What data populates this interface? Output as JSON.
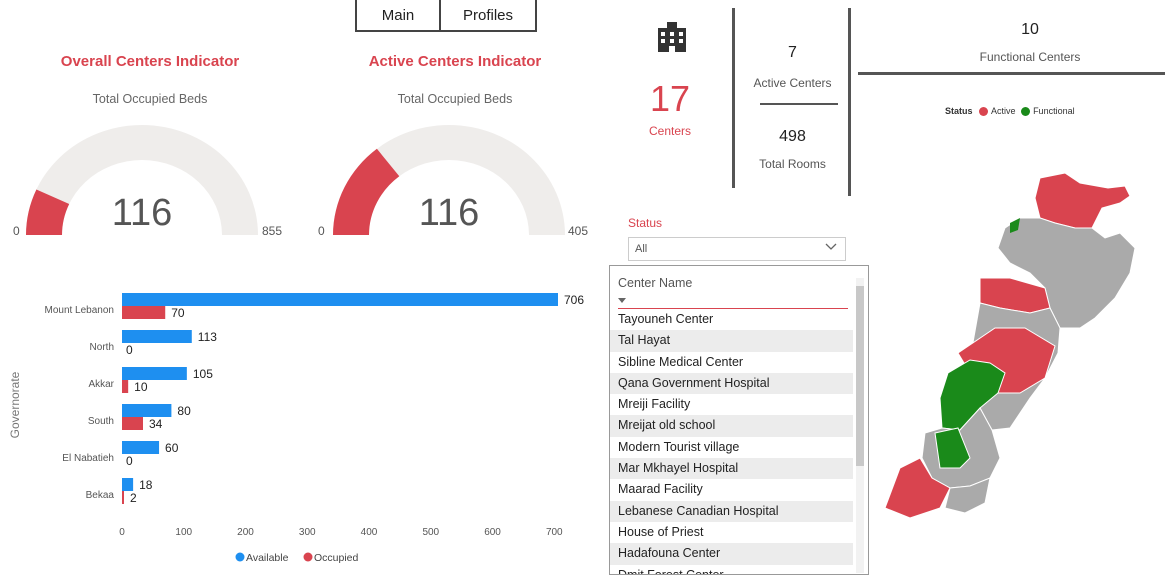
{
  "nav": {
    "main_label": "Main",
    "profiles_label": "Profiles"
  },
  "gauge_overall": {
    "title": "Overall Centers Indicator",
    "subtitle": "Total Occupied Beds",
    "value": "116",
    "min": "0",
    "max": "855"
  },
  "gauge_active": {
    "title": "Active Centers Indicator",
    "subtitle": "Total Occupied Beds",
    "value": "116",
    "min": "0",
    "max": "405"
  },
  "kpi": {
    "building_icon": "building-icon",
    "centers_value": "17",
    "centers_label": "Centers",
    "active_value": "7",
    "active_label": "Active Centers",
    "rooms_value": "498",
    "rooms_label": "Total Rooms",
    "functional_value": "10",
    "functional_label": "Functional Centers"
  },
  "map_legend": {
    "title": "Status",
    "items": [
      {
        "label": "Active",
        "color": "#d9444f"
      },
      {
        "label": "Functional",
        "color": "#1a8a1a"
      }
    ]
  },
  "status_slicer": {
    "title": "Status",
    "selected": "All"
  },
  "center_table": {
    "header": "Center Name",
    "rows": [
      "Tayouneh Center",
      "Tal Hayat",
      "Sibline Medical Center",
      "Qana Government Hospital",
      "Mreiji Facility",
      "Mreijat old school",
      "Modern Tourist village",
      "Mar Mkhayel Hospital",
      "Maarad Facility",
      "Lebanese Canadian Hospital",
      "House of Priest",
      "Hadafouna Center",
      "Dmit Forest Center"
    ]
  },
  "chart_data": {
    "type": "bar",
    "orientation": "horizontal",
    "categories": [
      "Mount Lebanon",
      "North",
      "Akkar",
      "South",
      "El Nabatieh",
      "Bekaa"
    ],
    "series": [
      {
        "name": "Available",
        "values": [
          706,
          113,
          105,
          80,
          60,
          18
        ],
        "color": "#1e8ff0"
      },
      {
        "name": "Occupied",
        "values": [
          70,
          0,
          10,
          34,
          0,
          2
        ],
        "color": "#d9444f"
      }
    ],
    "xlabel": "",
    "ylabel": "Governorate",
    "xlim": [
      0,
      750
    ],
    "xticks": [
      0,
      100,
      200,
      300,
      400,
      500,
      600,
      700
    ],
    "legend": "bottom",
    "grid": false
  }
}
